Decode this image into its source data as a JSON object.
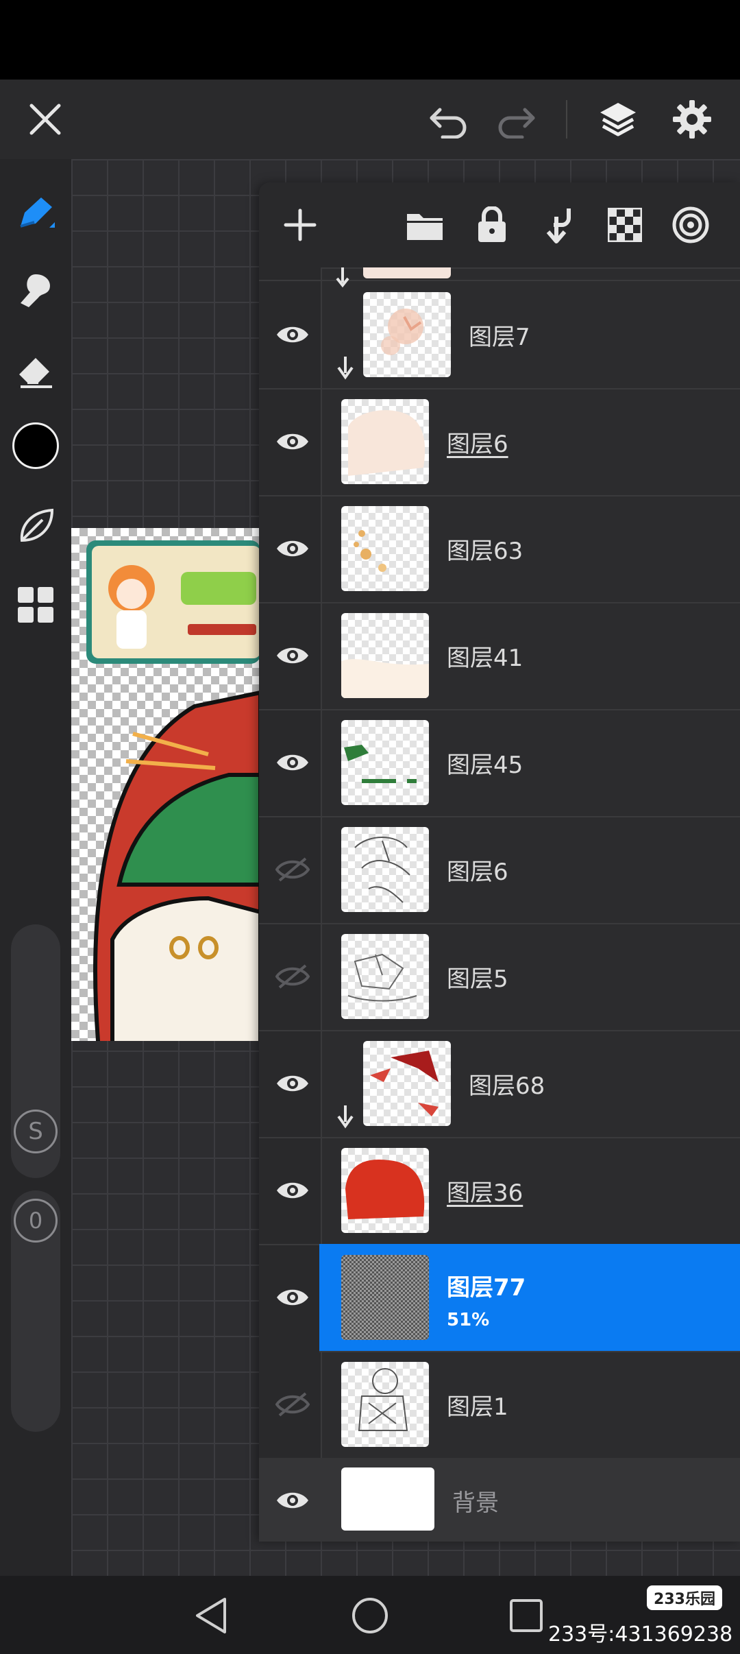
{
  "toolbar_top": {
    "close_icon": "close-icon",
    "undo_icon": "undo-icon",
    "redo_icon": "redo-icon",
    "layers_icon": "layers-icon",
    "settings_icon": "gear-icon"
  },
  "colors": {
    "accent": "#0a7bf2",
    "panel": "#2c2c2e",
    "current_color": "#000000"
  },
  "tools": [
    {
      "name": "pen-tool",
      "icon": "pen-icon",
      "active": true
    },
    {
      "name": "smudge-tool",
      "icon": "smudge-icon"
    },
    {
      "name": "eraser-tool",
      "icon": "eraser-icon"
    },
    {
      "name": "color-picker",
      "icon": "color-swatch"
    },
    {
      "name": "leaf-tool",
      "icon": "leaf-icon"
    },
    {
      "name": "gallery-tool",
      "icon": "grid-icon"
    }
  ],
  "sliders": {
    "size_label": "S",
    "opacity_label": "0"
  },
  "layers_panel": {
    "actions": [
      "add-layer",
      "folder",
      "lock",
      "merge-down",
      "transparency",
      "reference"
    ],
    "layers": [
      {
        "name": "图层7",
        "visible": true,
        "clipped": true
      },
      {
        "name": "图层6",
        "visible": true,
        "underlined": true
      },
      {
        "name": "图层63",
        "visible": true
      },
      {
        "name": "图层41",
        "visible": true
      },
      {
        "name": "图层45",
        "visible": true
      },
      {
        "name": "图层6",
        "visible": false
      },
      {
        "name": "图层5",
        "visible": false
      },
      {
        "name": "图层68",
        "visible": true,
        "clipped": true
      },
      {
        "name": "图层36",
        "visible": true,
        "underlined": true
      },
      {
        "name": "图层77",
        "visible": true,
        "selected": true,
        "opacity": "51%"
      },
      {
        "name": "图层1",
        "visible": false
      },
      {
        "name": "背景",
        "visible": true,
        "background": true
      }
    ]
  },
  "watermark": {
    "badge": "233乐园",
    "text": "233号:431369238"
  }
}
